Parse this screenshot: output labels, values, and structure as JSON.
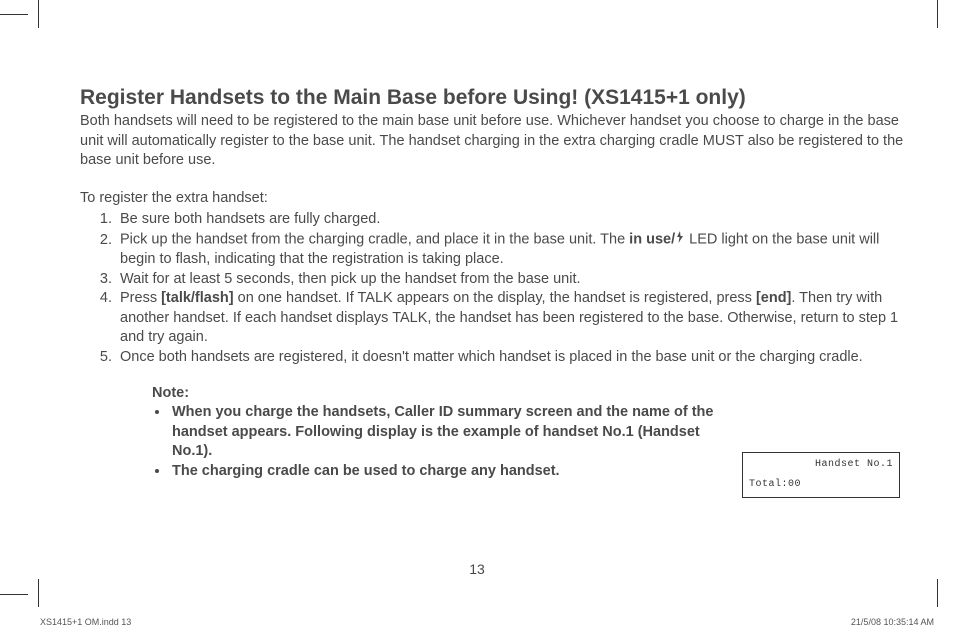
{
  "heading": "Register Handsets to the Main Base before Using! (XS1415+1 only)",
  "intro": "Both handsets will need to be registered to the main base unit before use. Whichever handset you choose to charge in the base unit will automatically register to the base unit. The handset charging in the extra charging cradle MUST also be registered to the base unit before use.",
  "sub": "To register the extra handset:",
  "steps": {
    "s1": "Be sure both handsets are fully charged.",
    "s2a": "Pick up the handset from the charging cradle, and place it in the base unit. The ",
    "s2_bold": "in use/",
    "s2b": " LED light on the base unit will begin to flash, indicating that the registration is taking place.",
    "s3": "Wait for at least 5 seconds, then pick up the handset from the base unit.",
    "s4a": "Press ",
    "s4_b1": "[talk/flash]",
    "s4b": " on one handset. If TALK appears on the display, the handset is registered, press ",
    "s4_b2": "[end]",
    "s4c": ". Then try with another handset. If each handset displays TALK, the handset has been registered to the base. Otherwise, return to step 1 and try again.",
    "s5": "Once both handsets are registered, it doesn't matter which handset is placed in the base unit or the charging cradle."
  },
  "note": {
    "label": "Note:",
    "n1": "When you charge the handsets, Caller ID summary screen and the name of the handset appears. Following display is the example of handset No.1 (Handset No.1).",
    "n2": "The charging cradle can be used to charge any handset."
  },
  "lcd": {
    "line1": "Handset No.1",
    "line2": "Total:00"
  },
  "page_number": "13",
  "footer": {
    "left": "XS1415+1 OM.indd   13",
    "right": "21/5/08   10:35:14 AM"
  }
}
